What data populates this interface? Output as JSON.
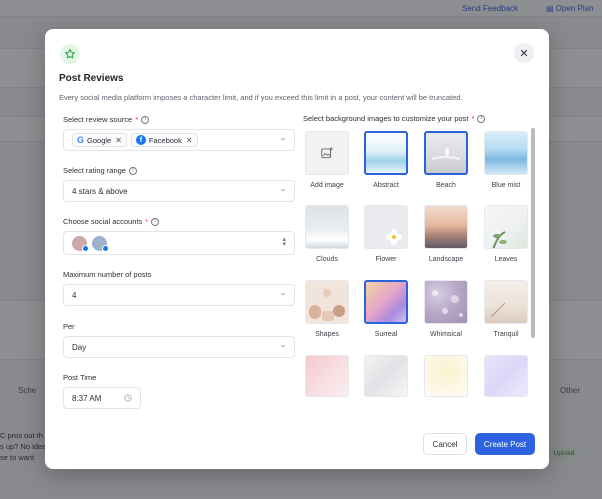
{
  "background": {
    "top_links": [
      "Send Feedback",
      "Open Plan"
    ],
    "tabs": [
      "Sche",
      "Other"
    ],
    "text_lines": [
      "C pros out th",
      "s up? No idea",
      "se to want"
    ],
    "badge": "Upload"
  },
  "modal": {
    "title": "Post Reviews",
    "description": "Every social media platform imposes a character limit, and if you exceed this limit in a post, your content will be truncated.",
    "close_icon": "close-icon",
    "header_icon": "star-icon",
    "review_source": {
      "label": "Select review source",
      "chips": [
        {
          "name": "Google",
          "icon": "google-logo"
        },
        {
          "name": "Facebook",
          "icon": "facebook-logo"
        }
      ]
    },
    "rating_range": {
      "label": "Select rating range",
      "value": "4 stars & above"
    },
    "social_accounts": {
      "label": "Choose social accounts"
    },
    "max_posts": {
      "label": "Maximum number of posts",
      "value": "4"
    },
    "per": {
      "label": "Per",
      "value": "Day"
    },
    "post_time": {
      "label": "Post Time",
      "value": "8:37 AM"
    },
    "background_images": {
      "label": "Select background images to customize your post",
      "items": [
        {
          "name": "Add image",
          "selected": false
        },
        {
          "name": "Abstract",
          "selected": true
        },
        {
          "name": "Beach",
          "selected": true
        },
        {
          "name": "Blue mist",
          "selected": false
        },
        {
          "name": "Clouds",
          "selected": false
        },
        {
          "name": "Flower",
          "selected": false
        },
        {
          "name": "Landscape",
          "selected": false
        },
        {
          "name": "Leaves",
          "selected": false
        },
        {
          "name": "Shapes",
          "selected": false
        },
        {
          "name": "Surreal",
          "selected": true
        },
        {
          "name": "Whimsical",
          "selected": false
        },
        {
          "name": "Tranquil",
          "selected": false
        }
      ]
    },
    "buttons": {
      "cancel": "Cancel",
      "create": "Create Post"
    },
    "colors": {
      "primary": "#2d63e0",
      "required": "#e03a3a",
      "selected_border": "#2d63d9"
    }
  }
}
